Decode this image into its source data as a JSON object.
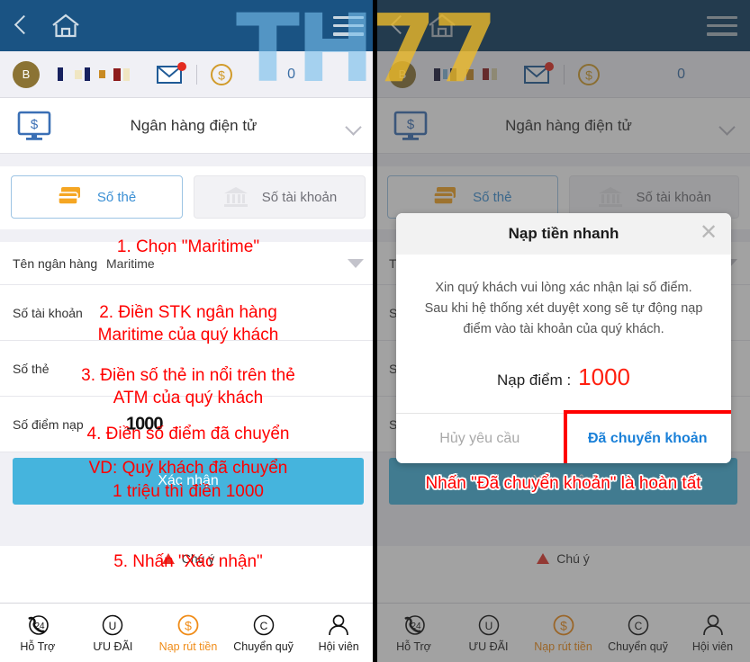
{
  "watermark": {
    "part1": "TH",
    "part2": "77"
  },
  "left_panel": {
    "topbar": {
      "back_icon": "chevron-left-icon",
      "home_icon": "home-icon",
      "menu_icon": "hamburger-icon"
    },
    "account": {
      "avatar_initial": "B",
      "username_masked": "",
      "mail_icon": "envelope-icon",
      "coin_icon": "dollar-coin-icon",
      "balance": "0"
    },
    "section": {
      "icon": "monitor-dollar-icon",
      "title": "Ngân hàng điện tử",
      "chevron": "chevron-down-icon"
    },
    "method_tabs": [
      {
        "label": "Số thẻ",
        "icon": "credit-card-icon",
        "active": true
      },
      {
        "label": "Số tài khoản",
        "icon": "bank-icon",
        "active": false
      }
    ],
    "form": {
      "bank_name": {
        "label": "Tên ngân hàng",
        "value": "Maritime"
      },
      "account_number": {
        "label": "Số tài khoản",
        "value": ""
      },
      "card_number": {
        "label": "Số thẻ",
        "value": ""
      },
      "deposit_points": {
        "label": "Số điểm nạp",
        "value": "1000"
      }
    },
    "confirm_label": "Xác nhận",
    "note": "Chú ý",
    "annotations": [
      "1. Chọn \"Maritime\"",
      "2. Điền STK ngân hàng",
      "Maritime của quý khách",
      "3. Điền số thẻ in nổi trên thẻ",
      "ATM của quý khách",
      "4. Điền số điểm đã chuyển",
      "VD: Quý khách đã chuyển",
      "1 triệu thì điền 1000",
      "5. Nhấn \"Xác nhận\""
    ]
  },
  "right_panel": {
    "topbar": {
      "back_icon": "chevron-left-icon",
      "home_icon": "home-icon",
      "menu_icon": "hamburger-icon"
    },
    "account": {
      "avatar_initial": "B",
      "mail_icon": "envelope-icon",
      "coin_icon": "dollar-coin-icon",
      "balance": "0"
    },
    "section": {
      "icon": "monitor-dollar-icon",
      "title": "Ngân hàng điện tử",
      "chevron": "chevron-down-icon"
    },
    "method_tabs": [
      {
        "label": "Số thẻ",
        "icon": "credit-card-icon",
        "active": true
      },
      {
        "label": "Số tài khoản",
        "icon": "bank-icon",
        "active": false
      }
    ],
    "form": {
      "bank_name": {
        "label": "T",
        "value": ""
      },
      "row2": {
        "label": "S"
      },
      "row3": {
        "label": "S"
      },
      "row4": {
        "label": "S"
      }
    },
    "confirm_label": "Xác nhận",
    "note": "Chú ý",
    "annotation": "Nhấn \"Đã chuyển khoản\" là hoàn tất",
    "modal": {
      "title": "Nạp tiền nhanh",
      "close_icon": "close-icon",
      "line1": "Xin quý khách vui lòng xác nhận lại số điểm.",
      "line2": "Sau khi hệ thống xét duyệt xong sẽ tự động nạp",
      "line3": "điểm vào tài khoản của quý khách.",
      "amount_label": "Nạp điểm :",
      "amount_value": "1000",
      "cancel_label": "Hủy yêu cầu",
      "confirm_label": "Đã chuyển khoản"
    }
  },
  "bottom_nav": [
    {
      "label": "Hỗ Trợ",
      "icon": "support-24-icon",
      "accent": false
    },
    {
      "label": "ƯU ĐÃI",
      "icon": "promotion-u-icon",
      "accent": false
    },
    {
      "label": "Nạp rút tiền",
      "icon": "deposit-withdraw-dollar-icon",
      "accent": true
    },
    {
      "label": "Chuyển quỹ",
      "icon": "transfer-c-icon",
      "accent": false
    },
    {
      "label": "Hội viên",
      "icon": "member-person-icon",
      "accent": false
    }
  ],
  "colors": {
    "topbar_blue": "#1a5383",
    "accent_orange": "#f08c18",
    "confirm_blue": "#45b4dd",
    "annotation_red": "#ff0000",
    "link_blue": "#3a8fd4"
  }
}
